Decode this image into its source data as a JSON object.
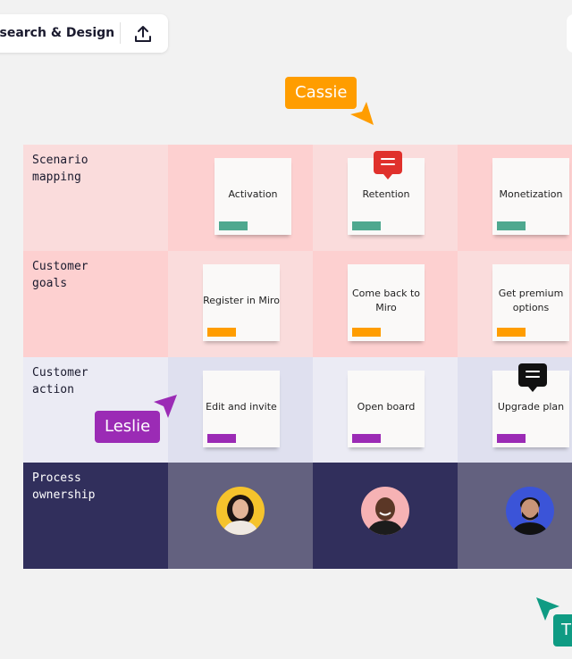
{
  "toolbar": {
    "board_title": "esearch & Design",
    "share_icon": "upload-icon"
  },
  "rows": [
    {
      "label": "Scenario\nmapping"
    },
    {
      "label": "Customer\ngoals"
    },
    {
      "label": "Customer\naction"
    },
    {
      "label": "Process\nownership"
    }
  ],
  "stickies": {
    "activation": "Activation",
    "retention": "Retention",
    "monetization": "Monetization",
    "register": "Register in Miro",
    "come_back": "Come back to Miro",
    "premium": "Get premium options",
    "edit_invite": "Edit and invite",
    "open_board": "Open board",
    "upgrade": "Upgrade plan"
  },
  "cursors": {
    "cassie": {
      "name": "Cassie",
      "color": "#ff9d00"
    },
    "leslie": {
      "name": "Leslie",
      "color": "#9b2bb5"
    },
    "third": {
      "name": "T",
      "color": "#0f9b83"
    }
  },
  "colors": {
    "tag_green": "#4ea88f",
    "tag_orange": "#ff9d00",
    "tag_purple": "#9b2bb5",
    "comment_red": "#e0312c",
    "comment_black": "#111111"
  }
}
